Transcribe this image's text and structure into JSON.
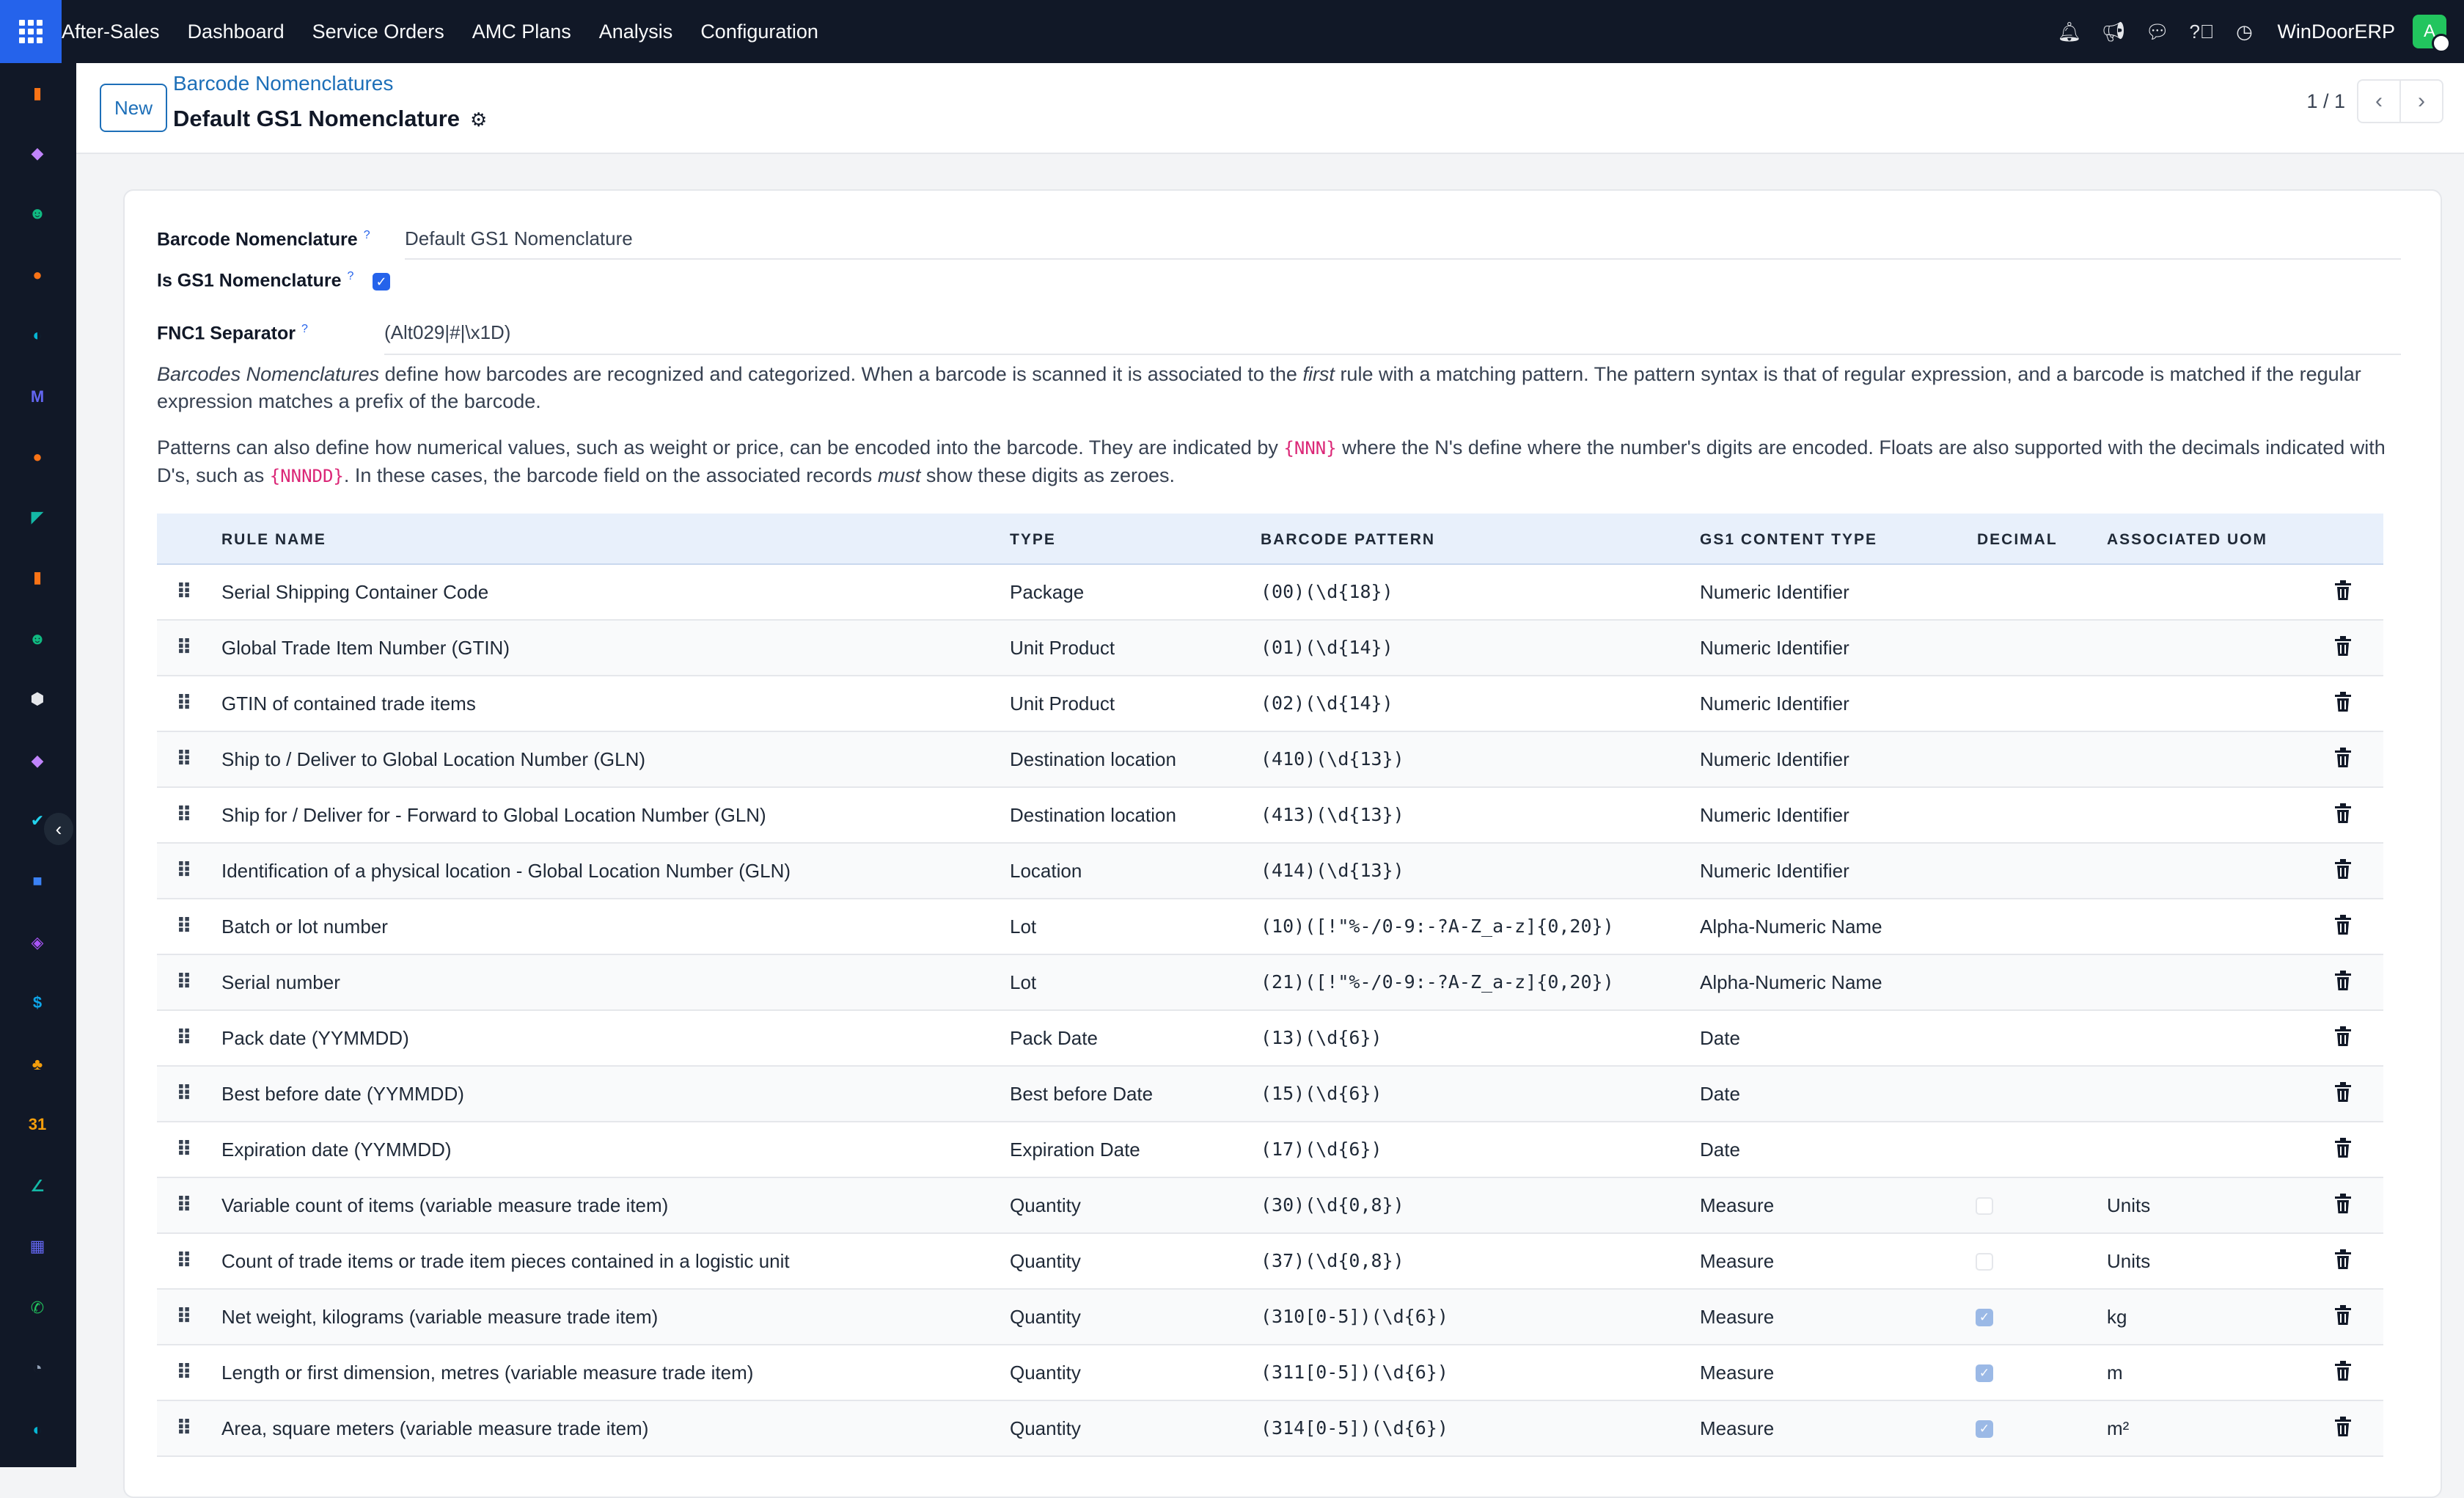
{
  "navbar": {
    "app_name": "After-Sales",
    "menu": [
      "Dashboard",
      "Service Orders",
      "AMC Plans",
      "Analysis",
      "Configuration"
    ],
    "company": "WinDoorERP",
    "avatar_letter": "A",
    "icons": [
      "bell-icon",
      "megaphone-icon",
      "chat-icon",
      "help-icon",
      "clock-icon"
    ]
  },
  "sidebar": {
    "apps": [
      {
        "name": "bar-chart-app-icon",
        "color": "#f97316",
        "glyph": "▮"
      },
      {
        "name": "puzzle-app-icon",
        "color": "#c084fc",
        "glyph": "◆"
      },
      {
        "name": "contacts-app-icon",
        "color": "#10b981",
        "glyph": "☻"
      },
      {
        "name": "chat-app-icon",
        "color": "#f97316",
        "glyph": "●"
      },
      {
        "name": "discuss-app-icon",
        "color": "#06b6d4",
        "glyph": "◐"
      },
      {
        "name": "mail-app-icon",
        "color": "#6366f1",
        "glyph": "M"
      },
      {
        "name": "chat-bubble-app-icon",
        "color": "#f97316",
        "glyph": "●"
      },
      {
        "name": "sign-app-icon",
        "color": "#14b8a6",
        "glyph": "◤"
      },
      {
        "name": "reports-app-icon",
        "color": "#f97316",
        "glyph": "▮"
      },
      {
        "name": "employees-app-icon",
        "color": "#10b981",
        "glyph": "☻"
      },
      {
        "name": "inventory-app-icon",
        "color": "#e5e7eb",
        "glyph": "⬢"
      },
      {
        "name": "planning-app-icon",
        "color": "#c084fc",
        "glyph": "◆"
      },
      {
        "name": "tasks-app-icon",
        "color": "#22d3ee",
        "glyph": "✔"
      },
      {
        "name": "knowledge-app-icon",
        "color": "#3b82f6",
        "glyph": "■"
      },
      {
        "name": "box-app-icon",
        "color": "#a855f7",
        "glyph": "◈"
      },
      {
        "name": "invoicing-app-icon",
        "color": "#0ea5e9",
        "glyph": "$"
      },
      {
        "name": "team-app-icon",
        "color": "#f59e0b",
        "glyph": "♣"
      },
      {
        "name": "calendar-app-icon",
        "color": "#f59e0b",
        "glyph": "31"
      },
      {
        "name": "pen-app-icon",
        "color": "#14b8a6",
        "glyph": "∠"
      },
      {
        "name": "dashboard-app-icon",
        "color": "#6366f1",
        "glyph": "▦"
      },
      {
        "name": "whatsapp-app-icon",
        "color": "#22c55e",
        "glyph": "✆"
      },
      {
        "name": "timer-app-icon",
        "color": "#94a3b8",
        "glyph": "◔"
      },
      {
        "name": "discuss2-app-icon",
        "color": "#06b6d4",
        "glyph": "◐"
      }
    ]
  },
  "control": {
    "new_label": "New",
    "breadcrumb": "Barcode Nomenclatures",
    "title": "Default GS1 Nomenclature",
    "pager": "1 / 1"
  },
  "form": {
    "nomenclature_label": "Barcode Nomenclature",
    "nomenclature_value": "Default GS1 Nomenclature",
    "is_gs1_label": "Is GS1 Nomenclature",
    "is_gs1_checked": true,
    "fnc1_label": "FNC1 Separator",
    "fnc1_value": "(Alt029|#|\\x1D)",
    "help_tip": "?",
    "help1_em1": "Barcodes Nomenclatures",
    "help1_a": " define how barcodes are recognized and categorized. When a barcode is scanned it is associated to the ",
    "help1_em2": "first",
    "help1_b": " rule with a matching pattern. The pattern syntax is that of regular expression, and a barcode is matched if the regular expression matches a prefix of the barcode.",
    "help2_a": "Patterns can also define how numerical values, such as weight or price, can be encoded into the barcode. They are indicated by ",
    "help2_code1": "{NNN}",
    "help2_b": " where the N's define where the number's digits are encoded. Floats are also supported with the decimals indicated with D's, such as ",
    "help2_code2": "{NNNDD}",
    "help2_c": ". In these cases, the barcode field on the associated records ",
    "help2_em": "must",
    "help2_d": " show these digits as zeroes."
  },
  "table": {
    "headers": {
      "rule_name": "RULE NAME",
      "type": "TYPE",
      "pattern": "BARCODE PATTERN",
      "gs1_type": "GS1 CONTENT TYPE",
      "decimal": "DECIMAL",
      "uom": "ASSOCIATED UOM"
    },
    "rows": [
      {
        "name": "Serial Shipping Container Code",
        "type": "Package",
        "pattern": "(00)(\\d{18})",
        "gs1": "Numeric Identifier",
        "decimal": null,
        "uom": ""
      },
      {
        "name": "Global Trade Item Number (GTIN)",
        "type": "Unit Product",
        "pattern": "(01)(\\d{14})",
        "gs1": "Numeric Identifier",
        "decimal": null,
        "uom": ""
      },
      {
        "name": "GTIN of contained trade items",
        "type": "Unit Product",
        "pattern": "(02)(\\d{14})",
        "gs1": "Numeric Identifier",
        "decimal": null,
        "uom": ""
      },
      {
        "name": "Ship to / Deliver to Global Location Number (GLN)",
        "type": "Destination location",
        "pattern": "(410)(\\d{13})",
        "gs1": "Numeric Identifier",
        "decimal": null,
        "uom": ""
      },
      {
        "name": "Ship for / Deliver for - Forward to Global Location Number (GLN)",
        "type": "Destination location",
        "pattern": "(413)(\\d{13})",
        "gs1": "Numeric Identifier",
        "decimal": null,
        "uom": ""
      },
      {
        "name": "Identification of a physical location - Global Location Number (GLN)",
        "type": "Location",
        "pattern": "(414)(\\d{13})",
        "gs1": "Numeric Identifier",
        "decimal": null,
        "uom": ""
      },
      {
        "name": "Batch or lot number",
        "type": "Lot",
        "pattern": "(10)([!\"%-/0-9:-?A-Z_a-z]{0,20})",
        "gs1": "Alpha-Numeric Name",
        "decimal": null,
        "uom": ""
      },
      {
        "name": "Serial number",
        "type": "Lot",
        "pattern": "(21)([!\"%-/0-9:-?A-Z_a-z]{0,20})",
        "gs1": "Alpha-Numeric Name",
        "decimal": null,
        "uom": ""
      },
      {
        "name": "Pack date (YYMMDD)",
        "type": "Pack Date",
        "pattern": "(13)(\\d{6})",
        "gs1": "Date",
        "decimal": null,
        "uom": ""
      },
      {
        "name": "Best before date (YYMMDD)",
        "type": "Best before Date",
        "pattern": "(15)(\\d{6})",
        "gs1": "Date",
        "decimal": null,
        "uom": ""
      },
      {
        "name": "Expiration date (YYMMDD)",
        "type": "Expiration Date",
        "pattern": "(17)(\\d{6})",
        "gs1": "Date",
        "decimal": null,
        "uom": ""
      },
      {
        "name": "Variable count of items (variable measure trade item)",
        "type": "Quantity",
        "pattern": "(30)(\\d{0,8})",
        "gs1": "Measure",
        "decimal": false,
        "uom": "Units"
      },
      {
        "name": "Count of trade items or trade item pieces contained in a logistic unit",
        "type": "Quantity",
        "pattern": "(37)(\\d{0,8})",
        "gs1": "Measure",
        "decimal": false,
        "uom": "Units"
      },
      {
        "name": "Net weight, kilograms (variable measure trade item)",
        "type": "Quantity",
        "pattern": "(310[0-5])(\\d{6})",
        "gs1": "Measure",
        "decimal": true,
        "uom": "kg"
      },
      {
        "name": "Length or first dimension, metres (variable measure trade item)",
        "type": "Quantity",
        "pattern": "(311[0-5])(\\d{6})",
        "gs1": "Measure",
        "decimal": true,
        "uom": "m"
      },
      {
        "name": "Area, square meters (variable measure trade item)",
        "type": "Quantity",
        "pattern": "(314[0-5])(\\d{6})",
        "gs1": "Measure",
        "decimal": true,
        "uom": "m²"
      }
    ]
  }
}
